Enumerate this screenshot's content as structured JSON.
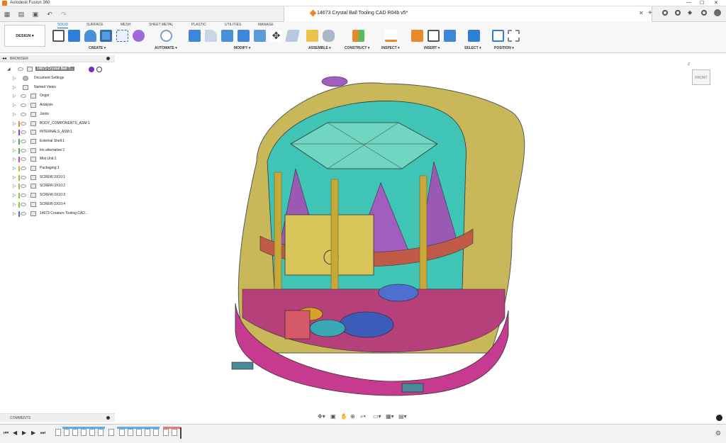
{
  "app": {
    "window_title": "Autodesk Fusion 360",
    "document_title": "14673 Crystal Ball Tooling CAD R04b v5*"
  },
  "ribbon": {
    "workspace_button": "DESIGN",
    "tabs": [
      "SOLID",
      "SURFACE",
      "MESH",
      "SHEET METAL",
      "PLASTIC",
      "UTILITIES",
      "MANAGE"
    ],
    "active_tab": "SOLID",
    "groups": [
      "CREATE",
      "AUTOMATE",
      "MODIFY",
      "ASSEMBLE",
      "CONSTRUCT",
      "INSPECT",
      "INSERT",
      "SELECT",
      "POSITION"
    ]
  },
  "browser": {
    "title": "BROWSER",
    "root_label": "14673 Crystal Ball T...",
    "items": [
      {
        "label": "Document Settings",
        "color": ""
      },
      {
        "label": "Named Views",
        "color": ""
      },
      {
        "label": "Origin",
        "color": ""
      },
      {
        "label": "Analysis",
        "color": ""
      },
      {
        "label": "Joints",
        "color": ""
      },
      {
        "label": "BODY_COMPONENTS_ASM:1",
        "color": "#e8892c"
      },
      {
        "label": "INTERNALS_ASM:1",
        "color": "#7a4cc8"
      },
      {
        "label": "External Shell:1",
        "color": "#4caf50"
      },
      {
        "label": "Iris alternative:1",
        "color": "#4caf50"
      },
      {
        "label": "Mist Unit:1",
        "color": "#c84c9a"
      },
      {
        "label": "Packaging:1",
        "color": "#c8b84c"
      },
      {
        "label": "SCREW-3X10:1",
        "color": "#8bc34a"
      },
      {
        "label": "SCREW-3X10:2",
        "color": "#8bc34a"
      },
      {
        "label": "SCREW-3X10:3",
        "color": "#8bc34a"
      },
      {
        "label": "SCREW-3X10:4",
        "color": "#8bc34a"
      },
      {
        "label": "14673 Creature Tooling CAD...",
        "color": "#3c78d8"
      }
    ]
  },
  "comments": {
    "title": "COMMENTS"
  },
  "viewcube": {
    "face_label": "FRONT"
  }
}
